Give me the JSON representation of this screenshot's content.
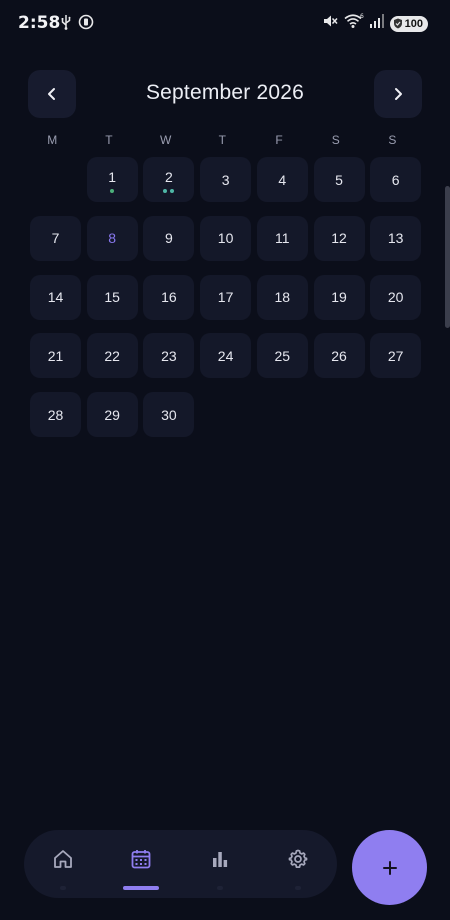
{
  "status_bar": {
    "time": "2:58",
    "battery_level": "100",
    "icons": [
      "usb-icon",
      "data-saver-icon",
      "mute-icon",
      "wifi-icon",
      "signal-icon",
      "battery-icon"
    ]
  },
  "calendar": {
    "month_title": "September 2026",
    "prev_icon": "chevron-left-icon",
    "next_icon": "chevron-right-icon",
    "weekdays": [
      "M",
      "T",
      "W",
      "T",
      "F",
      "S",
      "S"
    ],
    "today": 8,
    "first_weekday_index": 1,
    "days": [
      {
        "day": "1",
        "dots": [
          "#4caf7a"
        ]
      },
      {
        "day": "2",
        "dots": [
          "#4fb6a6",
          "#4fb6a6"
        ]
      },
      {
        "day": "3"
      },
      {
        "day": "4"
      },
      {
        "day": "5"
      },
      {
        "day": "6"
      },
      {
        "day": "7"
      },
      {
        "day": "8"
      },
      {
        "day": "9"
      },
      {
        "day": "10"
      },
      {
        "day": "11"
      },
      {
        "day": "12"
      },
      {
        "day": "13"
      },
      {
        "day": "14"
      },
      {
        "day": "15"
      },
      {
        "day": "16"
      },
      {
        "day": "17"
      },
      {
        "day": "18"
      },
      {
        "day": "19"
      },
      {
        "day": "20"
      },
      {
        "day": "21"
      },
      {
        "day": "22"
      },
      {
        "day": "23"
      },
      {
        "day": "24"
      },
      {
        "day": "25"
      },
      {
        "day": "26"
      },
      {
        "day": "27"
      },
      {
        "day": "28"
      },
      {
        "day": "29"
      },
      {
        "day": "30"
      }
    ]
  },
  "bottom_nav": {
    "items": [
      {
        "name": "home",
        "icon": "home-icon",
        "active": false
      },
      {
        "name": "calendar",
        "icon": "calendar-icon",
        "active": true
      },
      {
        "name": "stats",
        "icon": "bar-chart-icon",
        "active": false
      },
      {
        "name": "settings",
        "icon": "gear-icon",
        "active": false
      }
    ],
    "fab_icon": "plus-icon"
  },
  "colors": {
    "background": "#0b0e1a",
    "cell": "#141829",
    "accent": "#8f7ef0",
    "today_text": "#8878ee",
    "text": "#e6e7ef",
    "muted": "#9a9db0"
  }
}
